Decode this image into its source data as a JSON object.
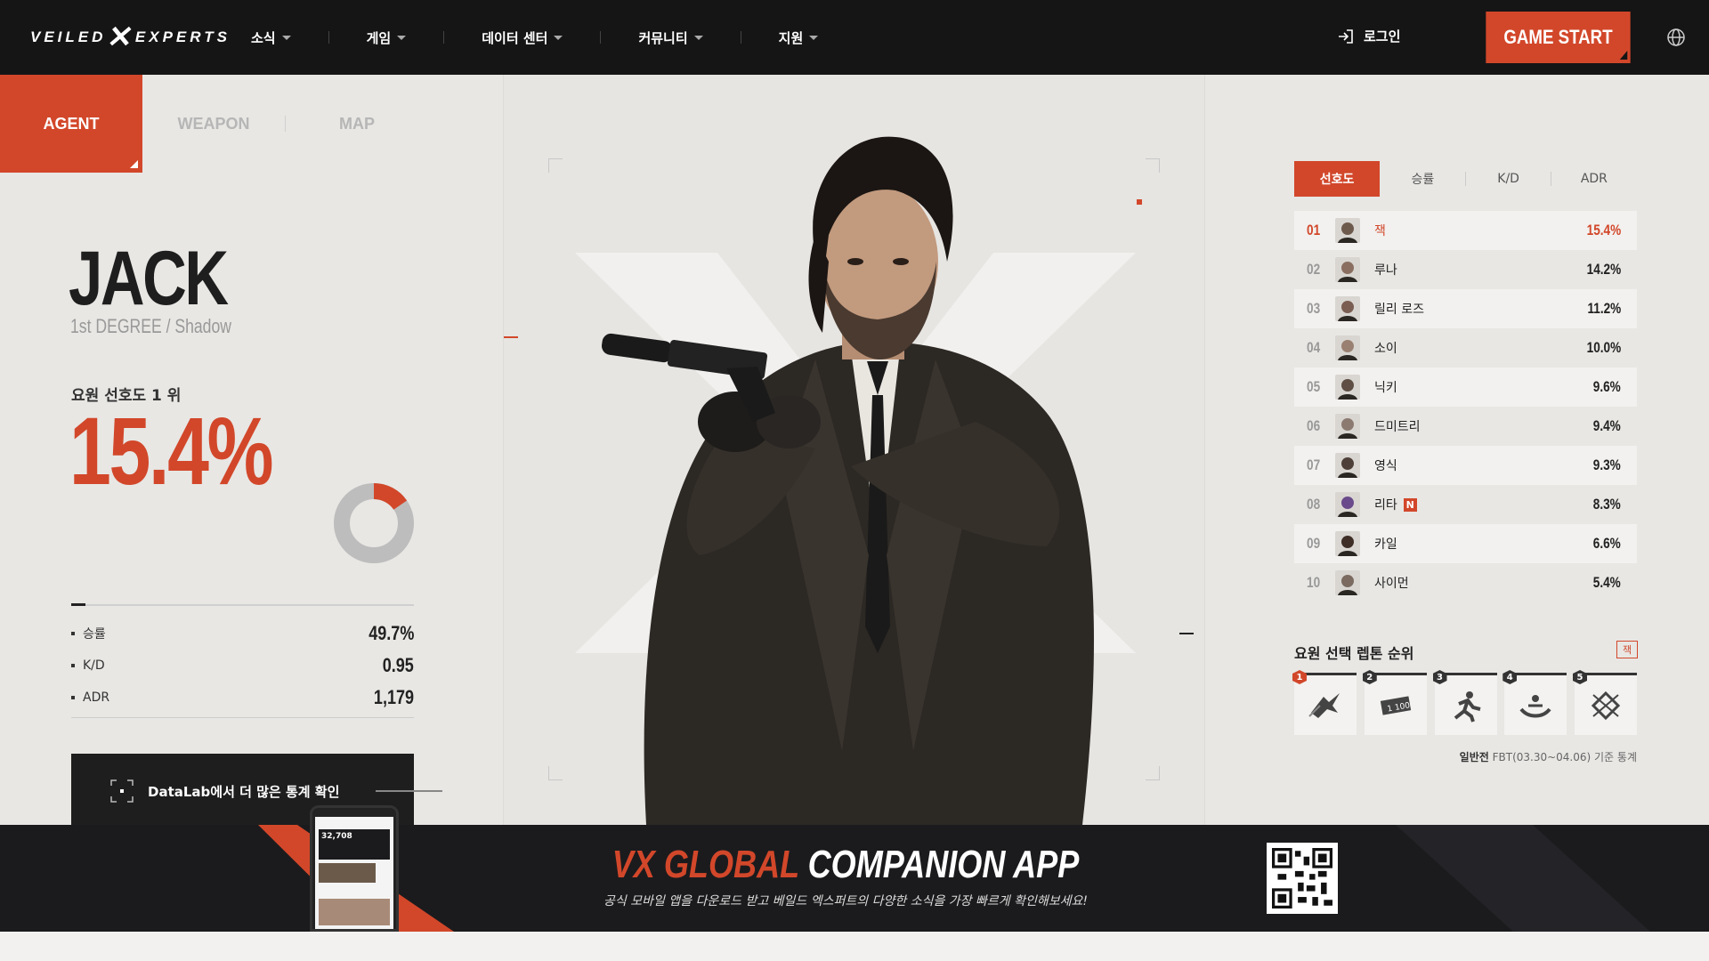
{
  "header": {
    "logo_text_left": "VEILED",
    "logo_text_right": "EXPERTS",
    "nav": [
      "소식",
      "게임",
      "데이터 센터",
      "커뮤니티",
      "지원"
    ],
    "login_label": "로그인",
    "game_start_label": "GAME START"
  },
  "left_tabs": [
    "AGENT",
    "WEAPON",
    "MAP"
  ],
  "agent": {
    "name": "JACK",
    "subtitle": "1st DEGREE / Shadow",
    "preference_label": "요원 선호도 1 위",
    "preference_value": "15.4%",
    "preference_fraction": 0.154,
    "stats": [
      {
        "label": "승률",
        "value": "49.7%"
      },
      {
        "label": "K/D",
        "value": "0.95"
      },
      {
        "label": "ADR",
        "value": "1,179"
      }
    ],
    "datalab_label": "DataLab에서 더 많은 통계 확인"
  },
  "ranking": {
    "tabs": [
      "선호도",
      "승률",
      "K/D",
      "ADR"
    ],
    "rows": [
      {
        "rank": "01",
        "name": "잭",
        "value": "15.4%",
        "is_new": false
      },
      {
        "rank": "02",
        "name": "루나",
        "value": "14.2%",
        "is_new": false
      },
      {
        "rank": "03",
        "name": "릴리 로즈",
        "value": "11.2%",
        "is_new": false
      },
      {
        "rank": "04",
        "name": "소이",
        "value": "10.0%",
        "is_new": false
      },
      {
        "rank": "05",
        "name": "닉키",
        "value": "9.6%",
        "is_new": false
      },
      {
        "rank": "06",
        "name": "드미트리",
        "value": "9.4%",
        "is_new": false
      },
      {
        "rank": "07",
        "name": "영식",
        "value": "9.3%",
        "is_new": false
      },
      {
        "rank": "08",
        "name": "리타",
        "value": "8.3%",
        "is_new": true
      },
      {
        "rank": "09",
        "name": "카일",
        "value": "6.6%",
        "is_new": false
      },
      {
        "rank": "10",
        "name": "사이먼",
        "value": "5.4%",
        "is_new": false
      }
    ],
    "new_badge": "N"
  },
  "rentone": {
    "title": "요원 선택 렙톤 순위",
    "agent_badge": "잭",
    "items": [
      "1",
      "2",
      "3",
      "4",
      "5"
    ],
    "footnote_bold": "일반전",
    "footnote_rest": "FBT(03.30~04.06) 기준 통계"
  },
  "banner": {
    "title_accent": "VX GLOBAL",
    "title_main": "COMPANION APP",
    "subtitle": "공식 모바일 앱을 다운로드 받고 베일드 엑스퍼트의 다양한 소식을 가장 빠르게 확인해보세요!",
    "phone_stat": "32,708"
  },
  "colors": {
    "accent": "#d2472a",
    "dark": "#151515"
  }
}
